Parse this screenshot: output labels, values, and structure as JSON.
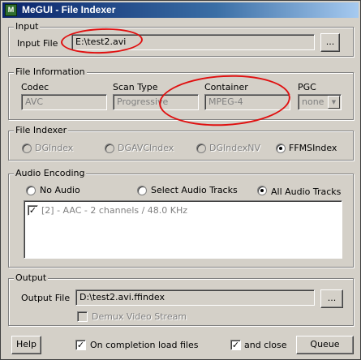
{
  "window": {
    "title": "MeGUI - File Indexer",
    "app_icon_text": "M"
  },
  "input": {
    "legend": "Input",
    "label": "Input File",
    "value": "E:\\test2.avi",
    "browse_label": "..."
  },
  "file_information": {
    "legend": "File Information",
    "codec_label": "Codec",
    "codec_value": "AVC",
    "scan_type_label": "Scan Type",
    "scan_type_value": "Progressive",
    "container_label": "Container",
    "container_value": "MPEG-4",
    "pgc_label": "PGC",
    "pgc_value": "none"
  },
  "file_indexer": {
    "legend": "File Indexer",
    "options": [
      "DGIndex",
      "DGAVCIndex",
      "DGIndexNV",
      "FFMSIndex"
    ],
    "selected": "FFMSIndex"
  },
  "audio_encoding": {
    "legend": "Audio Encoding",
    "options": [
      "No Audio",
      "Select Audio Tracks",
      "All Audio Tracks"
    ],
    "selected": "All Audio Tracks",
    "tracks": [
      {
        "label": "[2] - AAC - 2 channels / 48.0 KHz",
        "checked": true
      }
    ]
  },
  "output": {
    "legend": "Output",
    "label": "Output File",
    "value": "D:\\test2.avi.ffindex",
    "browse_label": "...",
    "demux_label": "Demux Video Stream"
  },
  "footer": {
    "help_label": "Help",
    "load_files_label": "On completion load files",
    "close_label": "and close",
    "queue_label": "Queue"
  },
  "colors": {
    "annotation": "#e01010",
    "title_bar": "#0a246a",
    "face": "#d4d0c8"
  }
}
